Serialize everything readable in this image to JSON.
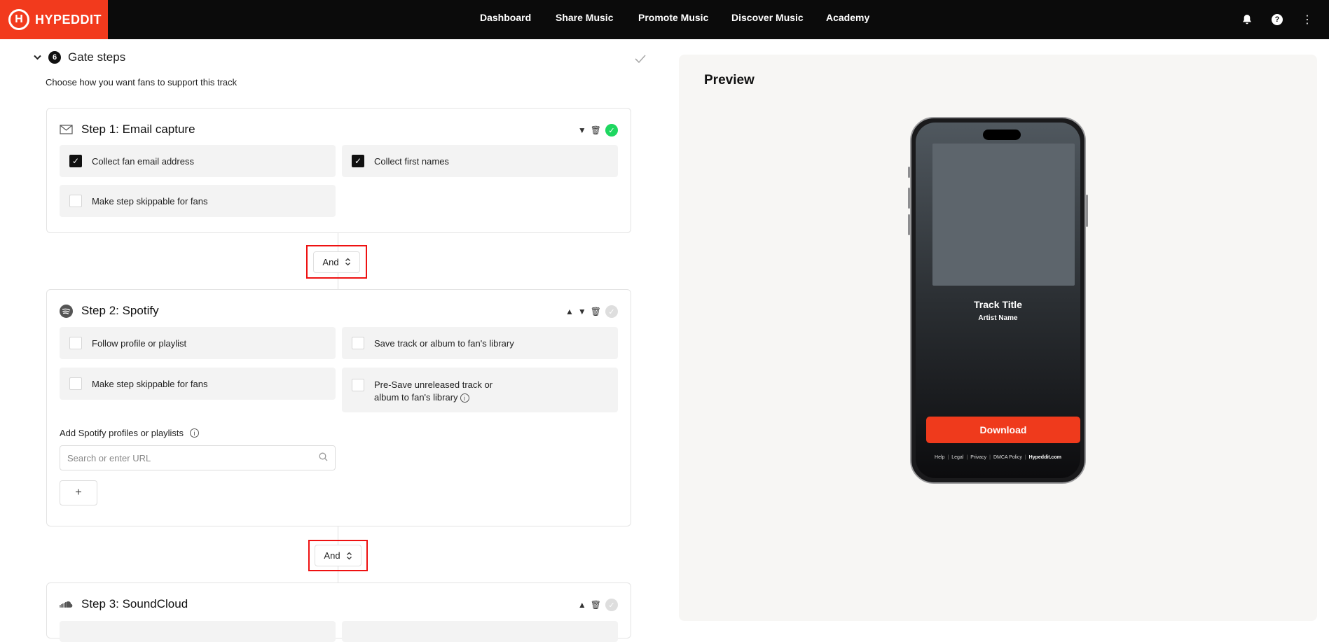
{
  "brand": {
    "name": "HYPEDDIT",
    "mark": "H",
    "color": "#f23a1d"
  },
  "nav": {
    "items": [
      "Dashboard",
      "Share Music",
      "Promote Music",
      "Discover Music",
      "Academy"
    ],
    "icons": [
      "bell-icon",
      "help-icon",
      "more-vertical-icon"
    ]
  },
  "gate": {
    "number": "6",
    "title": "Gate steps",
    "subtitle": "Choose how you want fans to support this track"
  },
  "steps": [
    {
      "title": "Step 1: Email capture",
      "icon": "mail-icon",
      "status": "complete",
      "options": [
        {
          "label": "Collect fan email address",
          "checked": true
        },
        {
          "label": "Collect first names",
          "checked": true
        },
        {
          "label": "Make step skippable for fans",
          "checked": false
        }
      ]
    },
    {
      "title": "Step 2: Spotify",
      "icon": "spotify-icon",
      "status": "incomplete",
      "options": [
        {
          "label": "Follow profile or playlist",
          "checked": false
        },
        {
          "label": "Save track or album to fan's library",
          "checked": false
        },
        {
          "label": "Make step skippable for fans",
          "checked": false
        },
        {
          "label_line1": "Pre-Save unreleased track or",
          "label_line2": "album to fan's library",
          "checked": false
        }
      ],
      "field_label": "Add Spotify profiles or playlists",
      "search_placeholder": "Search or enter URL",
      "add_label": "+"
    },
    {
      "title": "Step 3: SoundCloud",
      "icon": "soundcloud-icon",
      "status": "incomplete"
    }
  ],
  "connectors": [
    {
      "label": "And"
    },
    {
      "label": "And"
    }
  ],
  "preview": {
    "title": "Preview",
    "track_title": "Track Title",
    "artist_name": "Artist Name",
    "download_label": "Download",
    "footer_links": [
      "Help",
      "Legal",
      "Privacy",
      "DMCA Policy",
      "Hypeddit.com"
    ]
  }
}
